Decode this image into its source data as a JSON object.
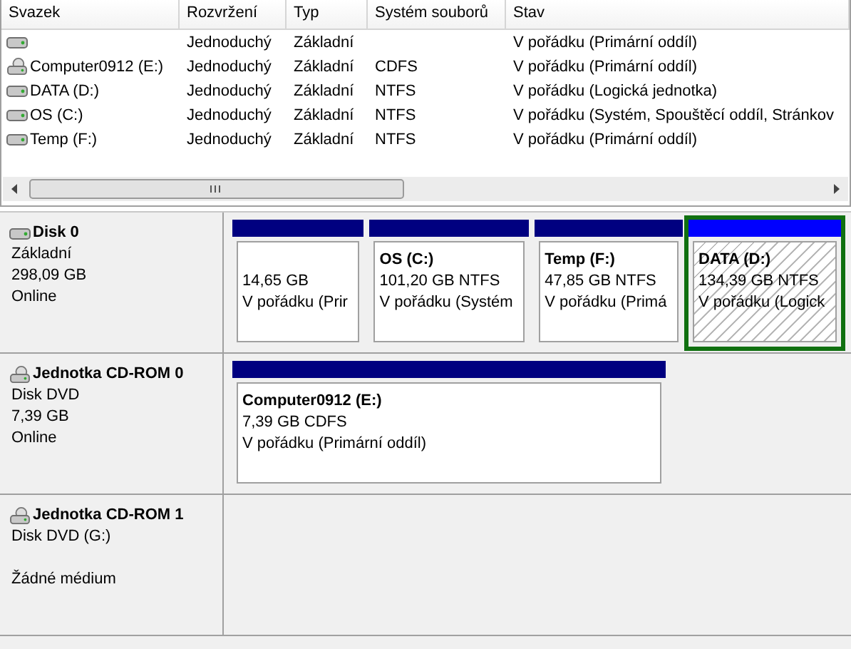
{
  "volume_list": {
    "columns": [
      "Svazek",
      "Rozvržení",
      "Typ",
      "Systém souborů",
      "Stav"
    ],
    "rows": [
      {
        "kind": "disk",
        "layout": "Jednoduchý",
        "type": "Základní",
        "status": "V pořádku (Primární oddíl)"
      },
      {
        "kind": "cd",
        "name": "Computer0912 (E:)",
        "layout": "Jednoduchý",
        "type": "Základní",
        "fs": "CDFS",
        "status": "V pořádku (Primární oddíl)"
      },
      {
        "kind": "disk",
        "name": "DATA (D:)",
        "layout": "Jednoduchý",
        "type": "Základní",
        "fs": "NTFS",
        "status": "V pořádku (Logická jednotka)"
      },
      {
        "kind": "disk",
        "name": "OS (C:)",
        "layout": "Jednoduchý",
        "type": "Základní",
        "fs": "NTFS",
        "status": "V pořádku (Systém, Spouštěcí oddíl, Stránkov"
      },
      {
        "kind": "disk",
        "name": "Temp (F:)",
        "layout": "Jednoduchý",
        "type": "Základní",
        "fs": "NTFS",
        "status": "V pořádku (Primární oddíl)"
      }
    ]
  },
  "disks": [
    {
      "kind": "disk",
      "title": "Disk 0",
      "type": "Základní",
      "capacity": "298,09 GB",
      "status": "Online",
      "partitions": [
        {
          "kind": "primary",
          "size": "14,65 GB",
          "status": "V pořádku (Prir",
          "selected": false
        },
        {
          "kind": "primary",
          "name": "OS  (C:)",
          "size": "101,20 GB NTFS",
          "status": "V pořádku (Systém",
          "selected": false
        },
        {
          "kind": "primary",
          "name": "Temp  (F:)",
          "size": "47,85 GB NTFS",
          "status": "V pořádku (Primá",
          "selected": false
        },
        {
          "kind": "logical",
          "name": "DATA  (D:)",
          "size": "134,39 GB NTFS",
          "status": "V pořádku (Logick",
          "selected": true
        }
      ]
    },
    {
      "kind": "cd",
      "title": "Jednotka CD-ROM 0",
      "type": "Disk DVD",
      "capacity": "7,39 GB",
      "status": "Online",
      "partitions": [
        {
          "kind": "primary",
          "name": "Computer0912  (E:)",
          "size": "7,39 GB CDFS",
          "status": "V pořádku (Primární oddíl)",
          "selected": false
        }
      ]
    },
    {
      "kind": "cd",
      "title": "Jednotka CD-ROM 1",
      "type": "Disk DVD (G:)",
      "status": "Žádné médium"
    }
  ]
}
